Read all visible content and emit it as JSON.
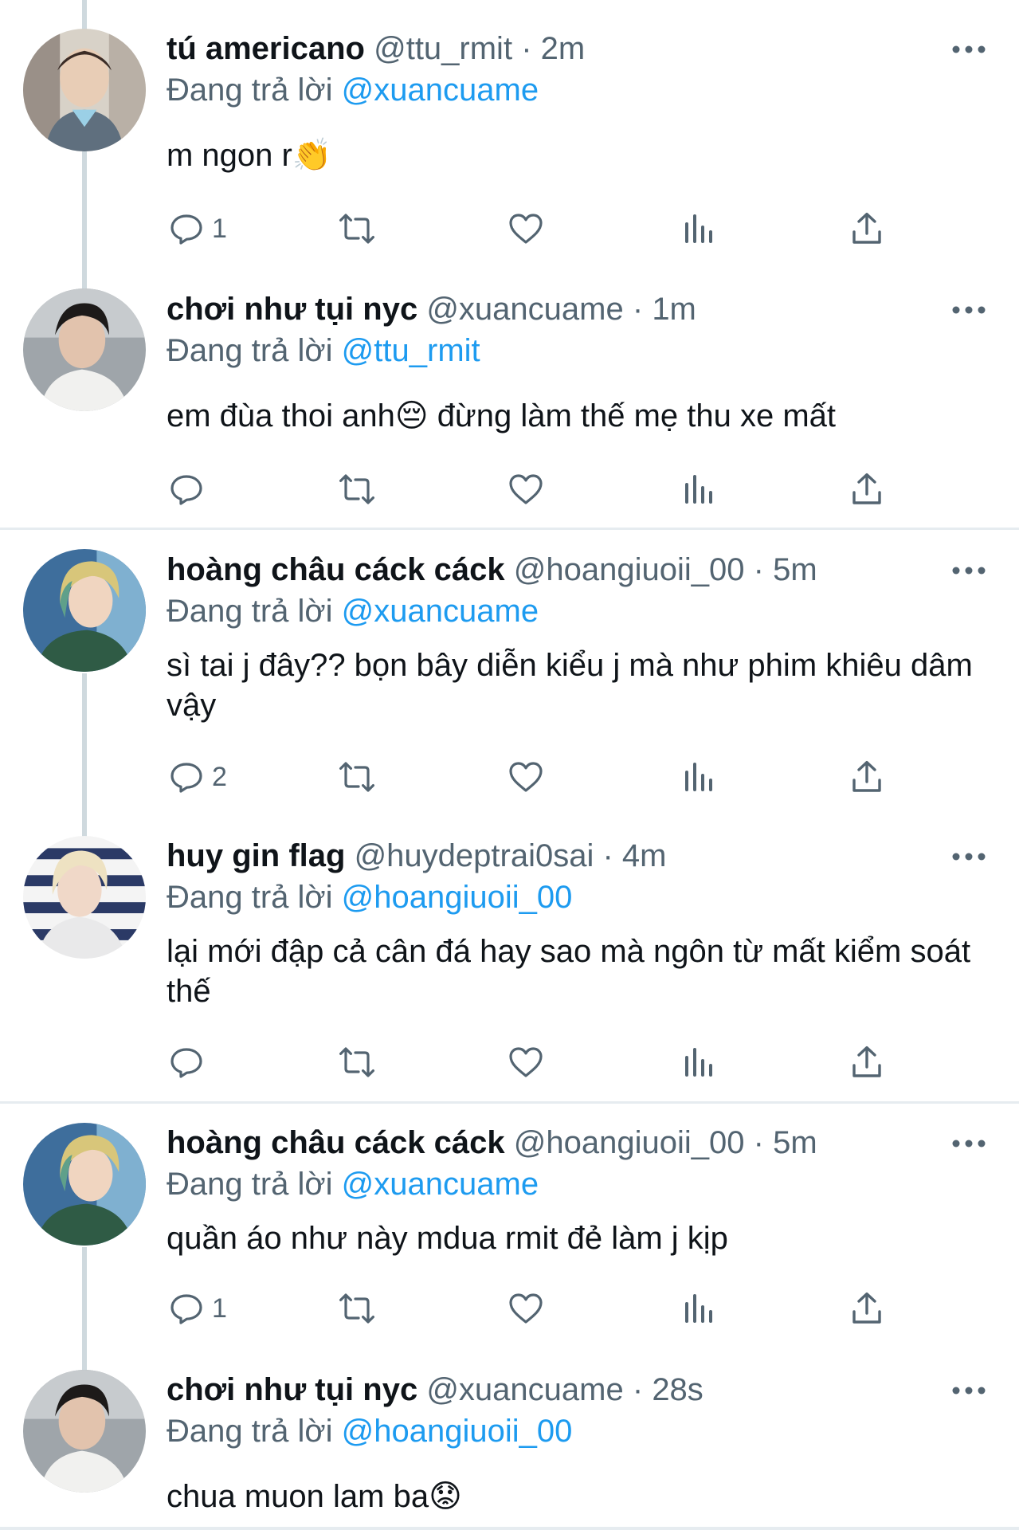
{
  "tweets": [
    {
      "name": "tú americano",
      "handle": "@ttu_rmit",
      "time": "2m",
      "reply_label": "Đang trả lời",
      "reply_to": "@xuancuame",
      "text": "m ngon r👏",
      "reply_count": "1"
    },
    {
      "name": "chơi như tụi nyc",
      "handle": "@xuancuame",
      "time": "1m",
      "reply_label": "Đang trả lời",
      "reply_to": "@ttu_rmit",
      "text": "em đùa thoi anh😔  đừng làm thế mẹ thu xe mất",
      "reply_count": ""
    },
    {
      "name": "hoàng châu cáck cáck",
      "handle": "@hoangiuoii_00",
      "time": "5m",
      "reply_label": "Đang trả lời",
      "reply_to": "@xuancuame",
      "text": "sì tai j đây?? bọn bây diễn kiểu j mà như phim khiêu dâm vậy",
      "reply_count": "2"
    },
    {
      "name": "huy gin flag",
      "handle": "@huydeptrai0sai",
      "time": "4m",
      "reply_label": "Đang trả lời",
      "reply_to": "@hoangiuoii_00",
      "text": "lại mới đập cả cân đá hay sao mà ngôn từ mất kiểm soát thế",
      "reply_count": ""
    },
    {
      "name": "hoàng châu cáck cáck",
      "handle": "@hoangiuoii_00",
      "time": "5m",
      "reply_label": "Đang trả lời",
      "reply_to": "@xuancuame",
      "text": "quần áo như này mdua rmit đẻ làm j kịp",
      "reply_count": "1"
    },
    {
      "name": "chơi như tụi nyc",
      "handle": "@xuancuame",
      "time": "28s",
      "reply_label": "Đang trả lời",
      "reply_to": "@hoangiuoii_00",
      "text": "chua muon lam ba😟",
      "reply_count": ""
    }
  ],
  "separator": "·",
  "icons": {
    "reply": "reply-icon",
    "retweet": "retweet-icon",
    "like": "heart-icon",
    "views": "analytics-icon",
    "share": "share-icon",
    "more": "more-icon"
  },
  "colors": {
    "mention": "#1d9bf0",
    "meta": "#536471",
    "text": "#0f1419",
    "thread_line": "#cfd9de"
  }
}
